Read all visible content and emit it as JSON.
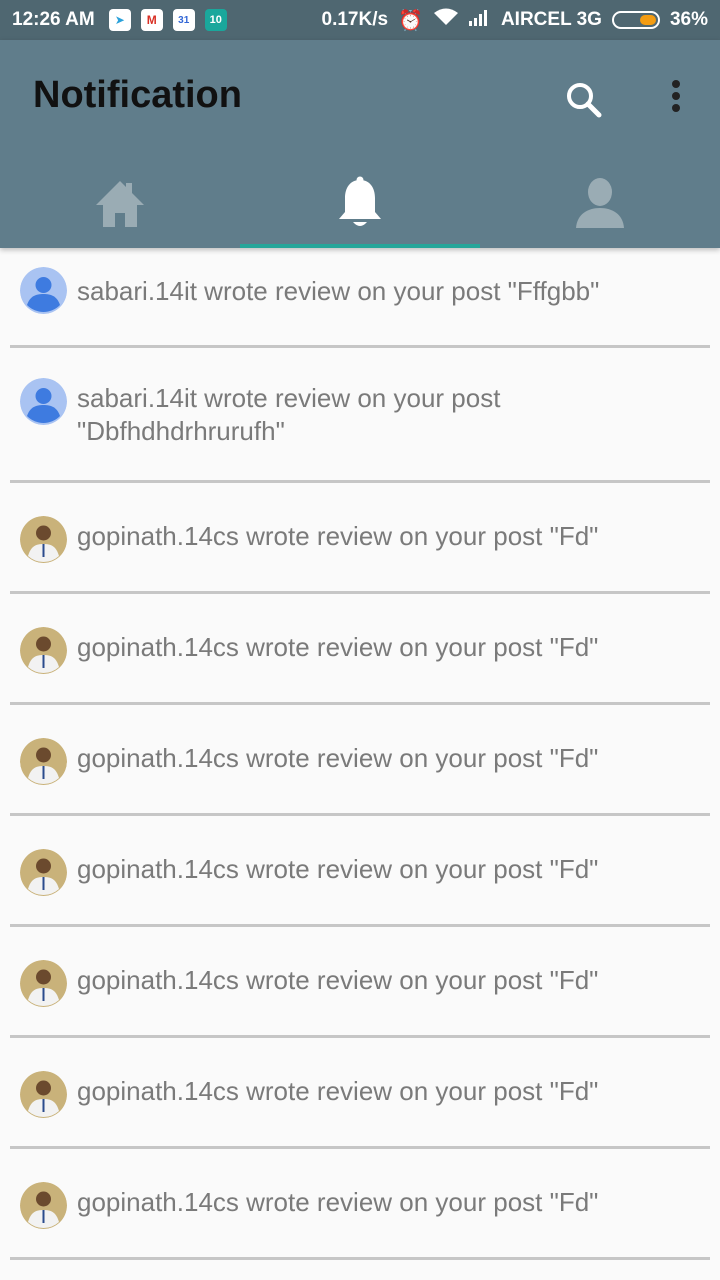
{
  "status_bar": {
    "time": "12:26 AM",
    "calendar_day": "31",
    "badge_count": "10",
    "net_speed": "0.17K/s",
    "carrier": "AIRCEL 3G",
    "battery": "36%",
    "battery_level": 0.36
  },
  "app_bar": {
    "title": "Notification",
    "search_icon": "search-icon",
    "menu_icon": "more-vert-icon"
  },
  "tabs": [
    {
      "icon": "home-icon",
      "active": false
    },
    {
      "icon": "bell-icon",
      "active": true
    },
    {
      "icon": "person-icon",
      "active": false
    }
  ],
  "colors": {
    "status_bar": "#4f6771",
    "app_bar": "#607d8b",
    "tab_indicator": "#26a69a",
    "list_background": "#fafafa",
    "message_text": "#7a7a7a"
  },
  "notifications": [
    {
      "avatar": "default-avatar",
      "text": "sabari.14it wrote review on your post \"Fffgbb\""
    },
    {
      "avatar": "default-avatar",
      "text": "sabari.14it wrote review on your post \"Dbfhdhdrhrurufh\""
    },
    {
      "avatar": "photo-avatar",
      "text": "gopinath.14cs wrote review on your post \"Fd\""
    },
    {
      "avatar": "photo-avatar",
      "text": "gopinath.14cs wrote review on your post \"Fd\""
    },
    {
      "avatar": "photo-avatar",
      "text": "gopinath.14cs wrote review on your post \"Fd\""
    },
    {
      "avatar": "photo-avatar",
      "text": "gopinath.14cs wrote review on your post \"Fd\""
    },
    {
      "avatar": "photo-avatar",
      "text": "gopinath.14cs wrote review on your post \"Fd\""
    },
    {
      "avatar": "photo-avatar",
      "text": "gopinath.14cs wrote review on your post \"Fd\""
    },
    {
      "avatar": "photo-avatar",
      "text": "gopinath.14cs wrote review on your post \"Fd\""
    }
  ]
}
